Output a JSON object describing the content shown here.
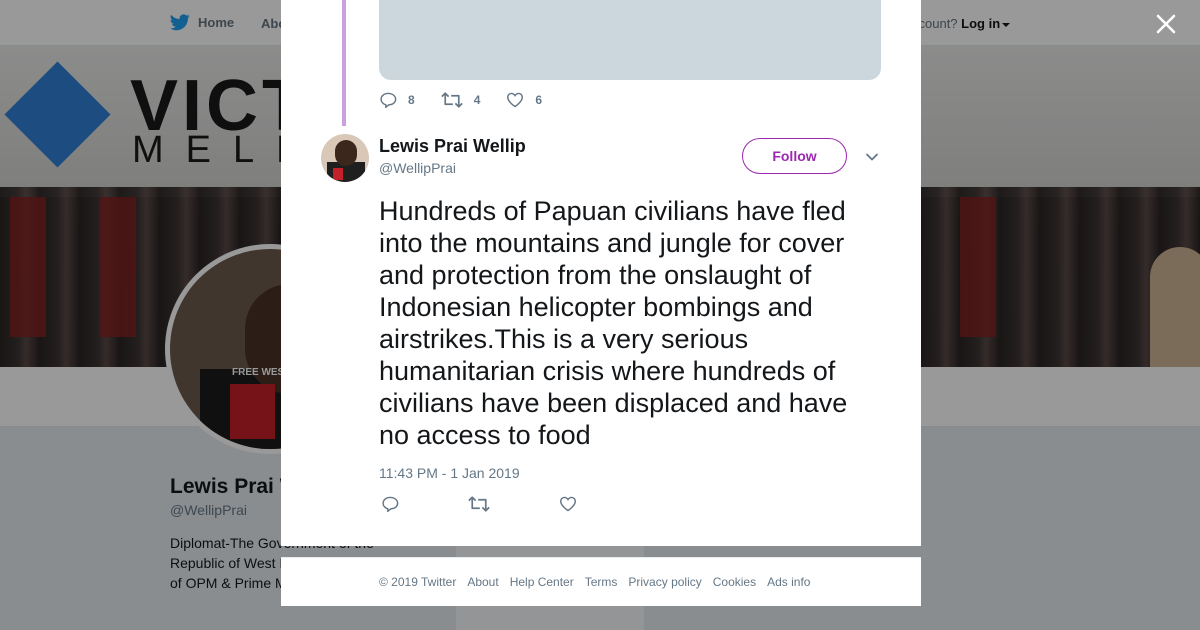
{
  "topbar": {
    "home_label": "Home",
    "about_label": "About",
    "login_prefix": "ccount?",
    "login_label": "Log in"
  },
  "banner": {
    "text_line1": "VICTO",
    "text_line2": "MELB"
  },
  "profile": {
    "name": "Lewis Prai Wellip",
    "handle": "@WellipPrai",
    "bio": "Diplomat-The Government of the Republic of West Papua. Representative of OPM & Prime Minister of West Papua.",
    "shirt_text": "FREE WEST"
  },
  "prev_tweet": {
    "reply_count": "8",
    "retweet_count": "4",
    "like_count": "6"
  },
  "tweet": {
    "author_name": "Lewis Prai Wellip",
    "author_handle": "@WellipPrai",
    "follow_label": "Follow",
    "text": "Hundreds of Papuan civilians have fled into the mountains and jungle for cover and protection from the onslaught of Indonesian helicopter bombings and airstrikes.This is a very serious humanitarian crisis where hundreds of civilians have been displaced and have no access to food",
    "timestamp": "11:43 PM - 1 Jan 2019"
  },
  "footer": {
    "links": [
      "© 2019 Twitter",
      "About",
      "Help Center",
      "Terms",
      "Privacy policy",
      "Cookies",
      "Ads info"
    ]
  },
  "colors": {
    "accent": "#9c27b0",
    "thread_line": "#c9a1e0",
    "twitter_blue": "#1da1f2",
    "muted_text": "#657786"
  },
  "icons": {
    "close": "close-icon",
    "reply": "reply-icon",
    "retweet": "retweet-icon",
    "like": "heart-icon",
    "logo": "twitter-bird-icon"
  }
}
